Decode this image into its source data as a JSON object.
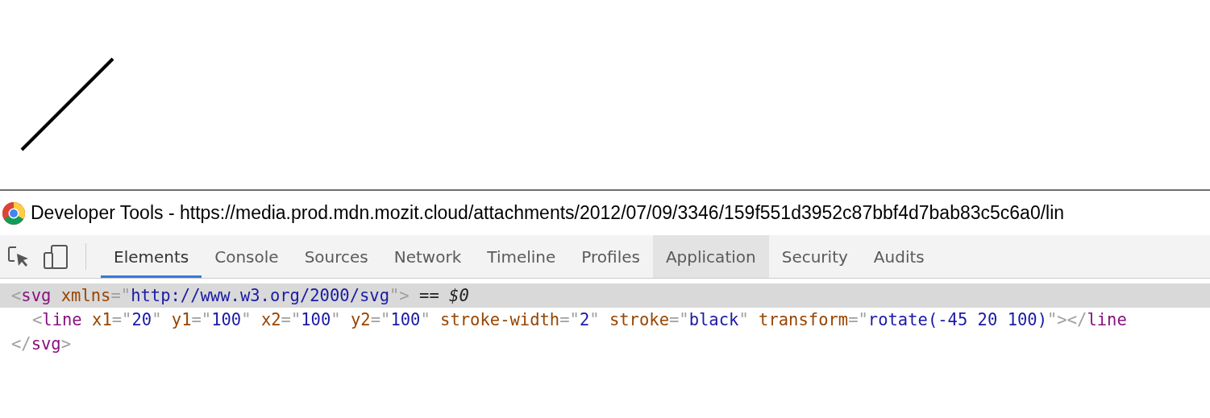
{
  "window": {
    "title": "Developer Tools - https://media.prod.mdn.mozit.cloud/attachments/2012/07/09/3346/159f551d3952c87bbf4d7bab83c5c6a0/lin"
  },
  "tabs": [
    {
      "label": "Elements",
      "selected": true,
      "hovered": false
    },
    {
      "label": "Console",
      "selected": false,
      "hovered": false
    },
    {
      "label": "Sources",
      "selected": false,
      "hovered": false
    },
    {
      "label": "Network",
      "selected": false,
      "hovered": false
    },
    {
      "label": "Timeline",
      "selected": false,
      "hovered": false
    },
    {
      "label": "Profiles",
      "selected": false,
      "hovered": false
    },
    {
      "label": "Application",
      "selected": false,
      "hovered": true
    },
    {
      "label": "Security",
      "selected": false,
      "hovered": false
    },
    {
      "label": "Audits",
      "selected": false,
      "hovered": false
    }
  ],
  "dom_tree": [
    {
      "selected": true,
      "tokens": [
        {
          "kind": "punct",
          "text": "<"
        },
        {
          "kind": "tag",
          "text": "svg"
        },
        {
          "kind": "attr",
          "text": " xmlns"
        },
        {
          "kind": "punct",
          "text": "=\""
        },
        {
          "kind": "value",
          "text": "http://www.w3.org/2000/svg"
        },
        {
          "kind": "punct",
          "text": "\">"
        },
        {
          "kind": "note",
          "text": " == $0"
        }
      ],
      "children": [
        {
          "selected": false,
          "tokens": [
            {
              "kind": "punct",
              "text": "<"
            },
            {
              "kind": "tag",
              "text": "line"
            },
            {
              "kind": "attr",
              "text": " x1"
            },
            {
              "kind": "punct",
              "text": "=\""
            },
            {
              "kind": "value",
              "text": "20"
            },
            {
              "kind": "punct",
              "text": "\""
            },
            {
              "kind": "attr",
              "text": " y1"
            },
            {
              "kind": "punct",
              "text": "=\""
            },
            {
              "kind": "value",
              "text": "100"
            },
            {
              "kind": "punct",
              "text": "\""
            },
            {
              "kind": "attr",
              "text": " x2"
            },
            {
              "kind": "punct",
              "text": "=\""
            },
            {
              "kind": "value",
              "text": "100"
            },
            {
              "kind": "punct",
              "text": "\""
            },
            {
              "kind": "attr",
              "text": " y2"
            },
            {
              "kind": "punct",
              "text": "=\""
            },
            {
              "kind": "value",
              "text": "100"
            },
            {
              "kind": "punct",
              "text": "\""
            },
            {
              "kind": "attr",
              "text": " stroke-width"
            },
            {
              "kind": "punct",
              "text": "=\""
            },
            {
              "kind": "value",
              "text": "2"
            },
            {
              "kind": "punct",
              "text": "\""
            },
            {
              "kind": "attr",
              "text": " stroke"
            },
            {
              "kind": "punct",
              "text": "=\""
            },
            {
              "kind": "value",
              "text": "black"
            },
            {
              "kind": "punct",
              "text": "\""
            },
            {
              "kind": "attr",
              "text": " transform"
            },
            {
              "kind": "punct",
              "text": "=\""
            },
            {
              "kind": "value",
              "text": "rotate(-45 20 100)"
            },
            {
              "kind": "punct",
              "text": "\"></"
            },
            {
              "kind": "tag",
              "text": "line"
            }
          ]
        }
      ],
      "close_tokens": [
        {
          "kind": "punct",
          "text": "</"
        },
        {
          "kind": "tag",
          "text": "svg"
        },
        {
          "kind": "punct",
          "text": ">"
        }
      ]
    }
  ]
}
